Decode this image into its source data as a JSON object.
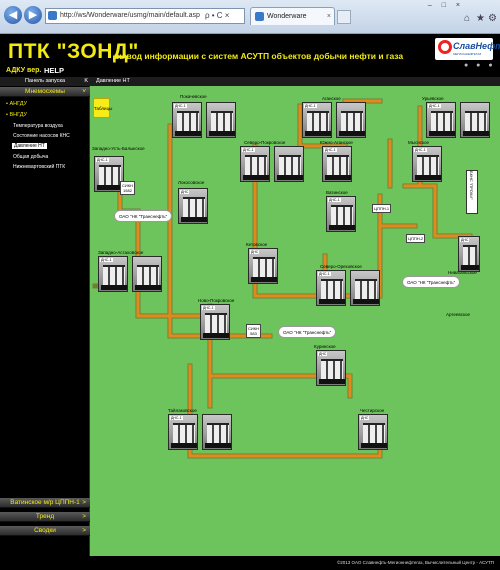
{
  "browser": {
    "address": "http://ws/Wonderware/usmg/main/default.asp",
    "address_tools": "ρ • C ×",
    "tab_title": "Wonderware",
    "tab_close": "×",
    "window_controls": "– □ ×"
  },
  "header": {
    "title": "ПТК \"ЗОНД\"",
    "subtitle": "вывод информации с систем АСУТП объектов добычи нефти и газа",
    "logo_text": "СлавНефть",
    "logo_sub": "МЕГИОННЕФТЕГАЗ",
    "icons": "● ● ●"
  },
  "menu": {
    "adku": "АДКУ вер.",
    "help": "HELP"
  },
  "sidebar": {
    "panel_title": "Панель запуска",
    "panel_k": "K",
    "section_mnemo": "Мнемосхемы",
    "group1": "• АНГДУ",
    "group2": "• ВНГДУ",
    "items": [
      "Температура воздуха",
      "Состояние насосов КНС",
      "Давление НТ",
      "Общая добыча",
      "Нижневартовский ПТК"
    ],
    "bottom": [
      "Ватинское м/р ЦППН-1",
      "Тренд",
      "Сводки"
    ],
    "arrow": ">"
  },
  "content": {
    "title": "Давление НТ",
    "tables_button": "Таблицы",
    "status": "©2013 ОАО Славнефть-Мегионнефтегаз, Вычислительный Центр - АСУТП"
  },
  "stations": [
    {
      "name": "Покачевское",
      "label": "ДНС-1"
    },
    {
      "name": "Аганское",
      "label": "ДНС-1"
    },
    {
      "name": "Урьевское",
      "label": "ДНС-1"
    },
    {
      "name": "Западно-Усть-Балыкское",
      "label": "ДНС-1"
    },
    {
      "name": "Северо-Покровское",
      "label": "ДНС-1"
    },
    {
      "name": "Южно-Аганское",
      "label": "ДНС-1"
    },
    {
      "name": "Мысиское",
      "label": "ДНС-1"
    },
    {
      "name": "Локосовское",
      "label": "ДНС"
    },
    {
      "name": "Ватинское",
      "label": "ДНС-1"
    },
    {
      "name": "Нивагальское",
      "label": "ДНС"
    },
    {
      "name": "Западно-Астаховское",
      "label": "ДНС-1"
    },
    {
      "name": "Кетовское",
      "label": "ДНС"
    },
    {
      "name": "Северо-Ореховское",
      "label": "ДНС-1"
    },
    {
      "name": "Артеевское",
      "label": "ДНС"
    },
    {
      "name": "Ново-Покровское",
      "label": "ДНС-1"
    },
    {
      "name": "Куринское",
      "label": "ДНС"
    },
    {
      "name": "Тайлаковское",
      "label": "ДНС-1"
    },
    {
      "name": "Честирское",
      "label": "ДНС"
    },
    {
      "name": "",
      "label": "ДНС"
    }
  ],
  "pills": [
    "ОАО \"НК \"Транснефть\"",
    "ОАО \"НК \"Транснефть\"",
    "ОАО \"НК \"Транснефть\""
  ],
  "smesh": [
    {
      "label": "СИКН",
      "value": "1582"
    },
    {
      "label": "СИКН",
      "value": "583"
    },
    {
      "label": "СИКН",
      "value": "–"
    }
  ],
  "cpps": [
    "ЦППН-1"
  ],
  "bkns": "БКНС \"ПРОХИ\"",
  "cpps2": "ЦППН-2"
}
